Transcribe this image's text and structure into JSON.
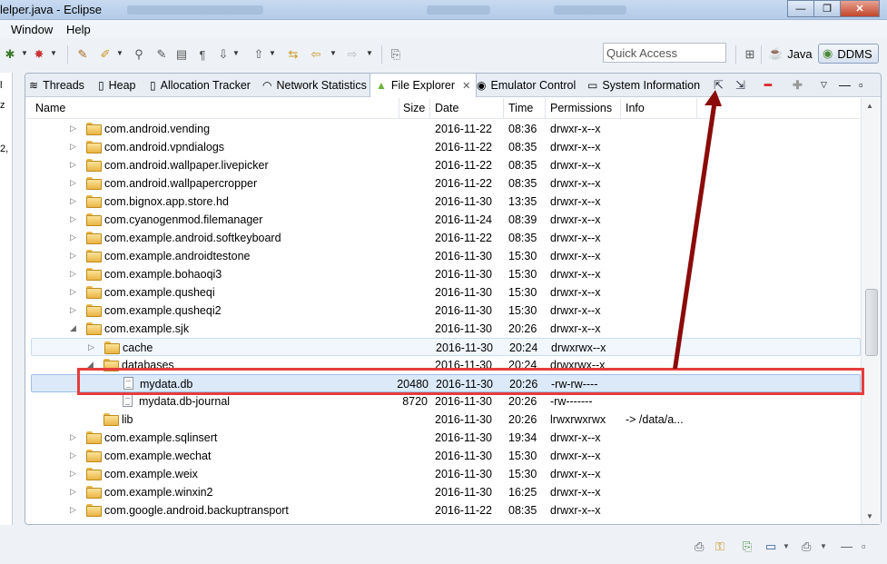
{
  "window": {
    "title": "lelper.java - Eclipse",
    "controls": {
      "minimize": "—",
      "maximize": "❐",
      "close": "✕"
    }
  },
  "menu": [
    "Window",
    "Help"
  ],
  "toolbar": {
    "quick_access_placeholder": "Quick Access",
    "perspectives": [
      {
        "label": "Java",
        "icon": "java-perspective-icon"
      },
      {
        "label": "DDMS",
        "icon": "ddms-perspective-icon",
        "active": true
      }
    ]
  },
  "left_stub": [
    "l",
    "z",
    "2,"
  ],
  "tabs": [
    {
      "label": "Threads",
      "icon": "threads-icon"
    },
    {
      "label": "Heap",
      "icon": "heap-icon"
    },
    {
      "label": "Allocation Tracker",
      "icon": "allocation-tracker-icon"
    },
    {
      "label": "Network Statistics",
      "icon": "network-statistics-icon"
    },
    {
      "label": "File Explorer",
      "icon": "android-icon",
      "active": true,
      "close": "✕"
    },
    {
      "label": "Emulator Control",
      "icon": "emulator-control-icon"
    },
    {
      "label": "System Information",
      "icon": "system-information-icon"
    }
  ],
  "columns": [
    "Name",
    "Size",
    "Date",
    "Time",
    "Permissions",
    "Info"
  ],
  "rows": [
    {
      "depth": 0,
      "twisty": "▷",
      "type": "folder",
      "name": "com.android.vending",
      "size": "",
      "date": "2016-11-22",
      "time": "08:36",
      "perm": "drwxr-x--x",
      "info": ""
    },
    {
      "depth": 0,
      "twisty": "▷",
      "type": "folder",
      "name": "com.android.vpndialogs",
      "size": "",
      "date": "2016-11-22",
      "time": "08:35",
      "perm": "drwxr-x--x",
      "info": ""
    },
    {
      "depth": 0,
      "twisty": "▷",
      "type": "folder",
      "name": "com.android.wallpaper.livepicker",
      "size": "",
      "date": "2016-11-22",
      "time": "08:35",
      "perm": "drwxr-x--x",
      "info": ""
    },
    {
      "depth": 0,
      "twisty": "▷",
      "type": "folder",
      "name": "com.android.wallpapercropper",
      "size": "",
      "date": "2016-11-22",
      "time": "08:35",
      "perm": "drwxr-x--x",
      "info": ""
    },
    {
      "depth": 0,
      "twisty": "▷",
      "type": "folder",
      "name": "com.bignox.app.store.hd",
      "size": "",
      "date": "2016-11-30",
      "time": "13:35",
      "perm": "drwxr-x--x",
      "info": ""
    },
    {
      "depth": 0,
      "twisty": "▷",
      "type": "folder",
      "name": "com.cyanogenmod.filemanager",
      "size": "",
      "date": "2016-11-24",
      "time": "08:39",
      "perm": "drwxr-x--x",
      "info": ""
    },
    {
      "depth": 0,
      "twisty": "▷",
      "type": "folder",
      "name": "com.example.android.softkeyboard",
      "size": "",
      "date": "2016-11-22",
      "time": "08:35",
      "perm": "drwxr-x--x",
      "info": ""
    },
    {
      "depth": 0,
      "twisty": "▷",
      "type": "folder",
      "name": "com.example.androidtestone",
      "size": "",
      "date": "2016-11-30",
      "time": "15:30",
      "perm": "drwxr-x--x",
      "info": ""
    },
    {
      "depth": 0,
      "twisty": "▷",
      "type": "folder",
      "name": "com.example.bohaoqi3",
      "size": "",
      "date": "2016-11-30",
      "time": "15:30",
      "perm": "drwxr-x--x",
      "info": ""
    },
    {
      "depth": 0,
      "twisty": "▷",
      "type": "folder",
      "name": "com.example.qusheqi",
      "size": "",
      "date": "2016-11-30",
      "time": "15:30",
      "perm": "drwxr-x--x",
      "info": ""
    },
    {
      "depth": 0,
      "twisty": "▷",
      "type": "folder",
      "name": "com.example.qusheqi2",
      "size": "",
      "date": "2016-11-30",
      "time": "15:30",
      "perm": "drwxr-x--x",
      "info": ""
    },
    {
      "depth": 0,
      "twisty": "◢",
      "type": "folder",
      "name": "com.example.sjk",
      "size": "",
      "date": "2016-11-30",
      "time": "20:26",
      "perm": "drwxr-x--x",
      "info": ""
    },
    {
      "depth": 1,
      "twisty": "▷",
      "type": "folder",
      "name": "cache",
      "size": "",
      "date": "2016-11-30",
      "time": "20:24",
      "perm": "drwxrwx--x",
      "info": "",
      "state": "hover"
    },
    {
      "depth": 1,
      "twisty": "◢",
      "type": "folder",
      "name": "databases",
      "size": "",
      "date": "2016-11-30",
      "time": "20:24",
      "perm": "drwxrwx--x",
      "info": ""
    },
    {
      "depth": 2,
      "twisty": "",
      "type": "file",
      "name": "mydata.db",
      "size": "20480",
      "date": "2016-11-30",
      "time": "20:26",
      "perm": "-rw-rw----",
      "info": "",
      "state": "selected"
    },
    {
      "depth": 2,
      "twisty": "",
      "type": "file",
      "name": "mydata.db-journal",
      "size": "8720",
      "date": "2016-11-30",
      "time": "20:26",
      "perm": "-rw-------",
      "info": ""
    },
    {
      "depth": 1,
      "twisty": "",
      "type": "folder",
      "name": "lib",
      "size": "",
      "date": "2016-11-30",
      "time": "20:26",
      "perm": "lrwxrwxrwx",
      "info": "-> /data/a..."
    },
    {
      "depth": 0,
      "twisty": "▷",
      "type": "folder",
      "name": "com.example.sqlinsert",
      "size": "",
      "date": "2016-11-30",
      "time": "19:34",
      "perm": "drwxr-x--x",
      "info": ""
    },
    {
      "depth": 0,
      "twisty": "▷",
      "type": "folder",
      "name": "com.example.wechat",
      "size": "",
      "date": "2016-11-30",
      "time": "15:30",
      "perm": "drwxr-x--x",
      "info": ""
    },
    {
      "depth": 0,
      "twisty": "▷",
      "type": "folder",
      "name": "com.example.weix",
      "size": "",
      "date": "2016-11-30",
      "time": "15:30",
      "perm": "drwxr-x--x",
      "info": ""
    },
    {
      "depth": 0,
      "twisty": "▷",
      "type": "folder",
      "name": "com.example.winxin2",
      "size": "",
      "date": "2016-11-30",
      "time": "16:25",
      "perm": "drwxr-x--x",
      "info": ""
    },
    {
      "depth": 0,
      "twisty": "▷",
      "type": "folder",
      "name": "com.google.android.backuptransport",
      "size": "",
      "date": "2016-11-22",
      "time": "08:35",
      "perm": "drwxr-x--x",
      "info": ""
    }
  ],
  "annotation": {
    "color": "#e53d3d",
    "arrow_color": "#8b0a0a"
  }
}
